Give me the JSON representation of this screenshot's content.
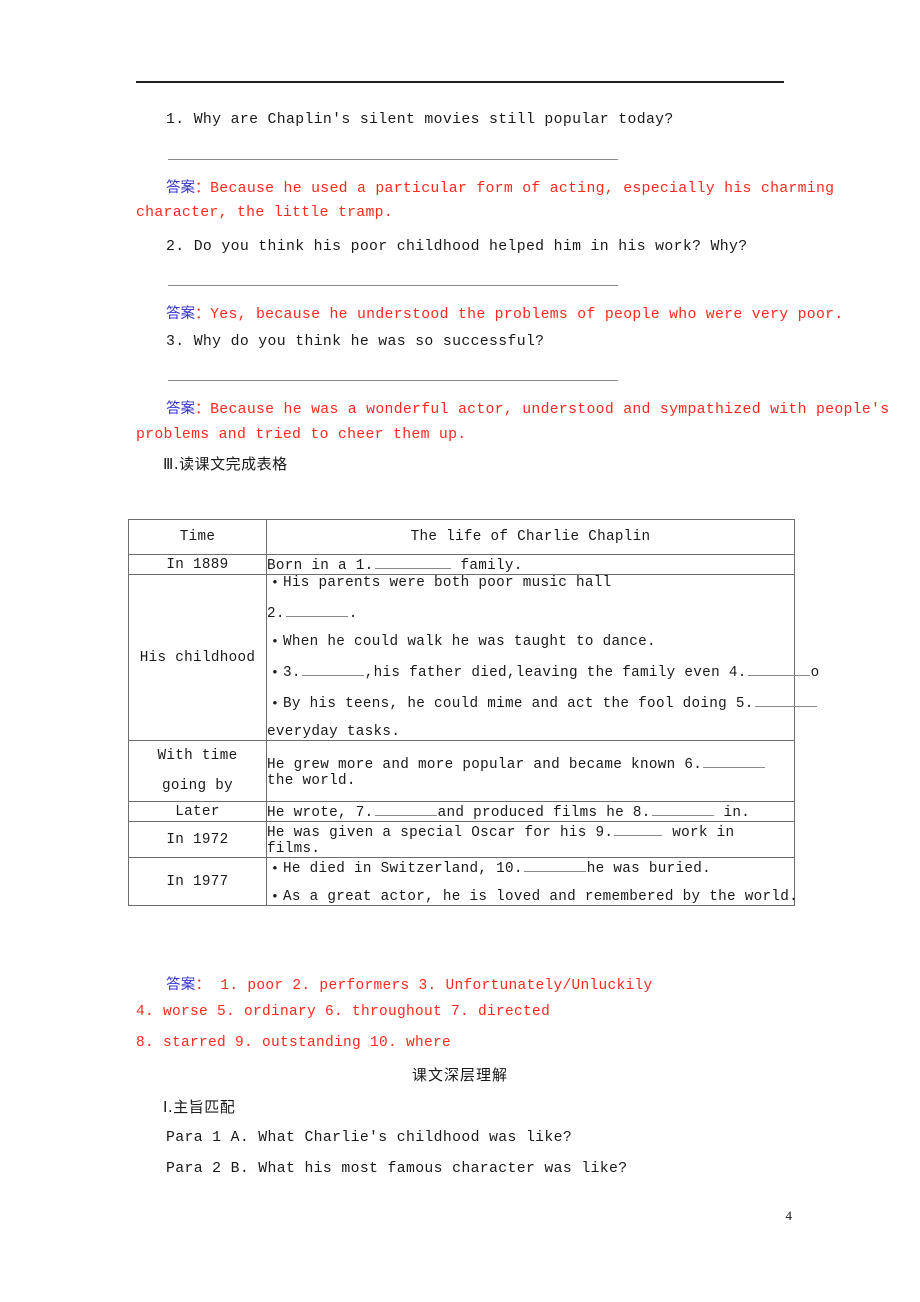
{
  "page": {
    "page_number": "4",
    "colors": {
      "answer_red": "#ff2a1f",
      "answer_label_blue": "#3333cc",
      "text_black": "#1a1a1a",
      "rule_gray": "#8a8a8a"
    }
  },
  "questions": [
    {
      "number": "1.",
      "text": "1. Why are Chaplin's silent movies still popular today?",
      "answer_label": "答案",
      "answer_colon": "：",
      "answer_text_line1": "Because he used a particular form of acting, especially his charming",
      "answer_text_line2": "character, the little tramp."
    },
    {
      "number": "2.",
      "text": "2. Do you think his poor childhood helped him in his work? Why?",
      "answer_label": "答案",
      "answer_colon": "：",
      "answer_text_line1": "Yes, because he understood the problems of people who were very poor.",
      "answer_text_line2": ""
    },
    {
      "number": "3.",
      "text": "3. Why do you think he was so successful?",
      "answer_label": "答案",
      "answer_colon": "：",
      "answer_text_line1": "Because he was a wonderful actor, understood and sympathized with people's",
      "answer_text_line2": "problems and tried to cheer them up."
    }
  ],
  "section_iii": {
    "heading": "Ⅲ.读课文完成表格"
  },
  "table": {
    "headers": [
      "Time",
      "The life of Charlie Chaplin"
    ],
    "rows": [
      {
        "time": "In 1889",
        "lines": [
          {
            "bullet": false,
            "pre": "Born in a 1.",
            "blank": "b-lg",
            "post": "  family."
          }
        ]
      },
      {
        "time": "His childhood",
        "lines": [
          {
            "bullet": true,
            "pre": "His parents were both poor music hall",
            "blank": "",
            "post": ""
          },
          {
            "bullet": false,
            "pre": "2.",
            "blank": "b-md",
            "post": "."
          },
          {
            "bullet": true,
            "pre": "When he could walk he was taught to dance.",
            "blank": "",
            "post": ""
          },
          {
            "bullet": true,
            "pre": "3.",
            "blank": "b-md",
            "post": ",his father died,leaving the family even 4.",
            "blank2": "b-md",
            "post2": "o"
          },
          {
            "bullet": true,
            "pre": "By his teens, he could mime and act the fool doing 5.",
            "blank": "b-md",
            "post": ""
          },
          {
            "bullet": false,
            "pre": "everyday tasks.",
            "blank": "",
            "post": ""
          }
        ]
      },
      {
        "time": "With time going by",
        "time_line1": "With time",
        "time_line2": "going by",
        "lines": [
          {
            "bullet": false,
            "pre": "He grew more and more popular and became known 6.",
            "blank": "b-md",
            "post": " the world."
          }
        ]
      },
      {
        "time": "Later",
        "lines": [
          {
            "bullet": false,
            "pre": "He wrote, 7.",
            "blank": "b-md",
            "post": "and produced films he 8.",
            "blank2": "b-md",
            "post2": " in."
          }
        ]
      },
      {
        "time": "In 1972",
        "lines": [
          {
            "bullet": false,
            "pre": "He was given a special Oscar for his 9.",
            "blank": "b-sm",
            "post": " work in films."
          }
        ]
      },
      {
        "time": "In 1977",
        "lines": [
          {
            "bullet": true,
            "pre": "He died in Switzerland, 10.",
            "blank": "b-md",
            "post": "he was buried."
          },
          {
            "bullet": true,
            "pre": "As a great actor, he is loved and remembered by the world.",
            "blank": "",
            "post": ""
          }
        ]
      }
    ]
  },
  "answer_key": {
    "label": "答案",
    "colon": "：",
    "line1": "1. poor   2. performers   3. Unfortunately/Unluckily",
    "line2": "4. worse   5. ordinary   6. throughout   7. directed",
    "line3": "8. starred   9. outstanding   10. where"
  },
  "deep_section": {
    "heading": "课文深层理解",
    "sub_heading": "Ⅰ.主旨匹配",
    "matches": [
      "Para 1  A. What Charlie's childhood was like?",
      "Para 2  B. What his most famous character was like?"
    ]
  }
}
